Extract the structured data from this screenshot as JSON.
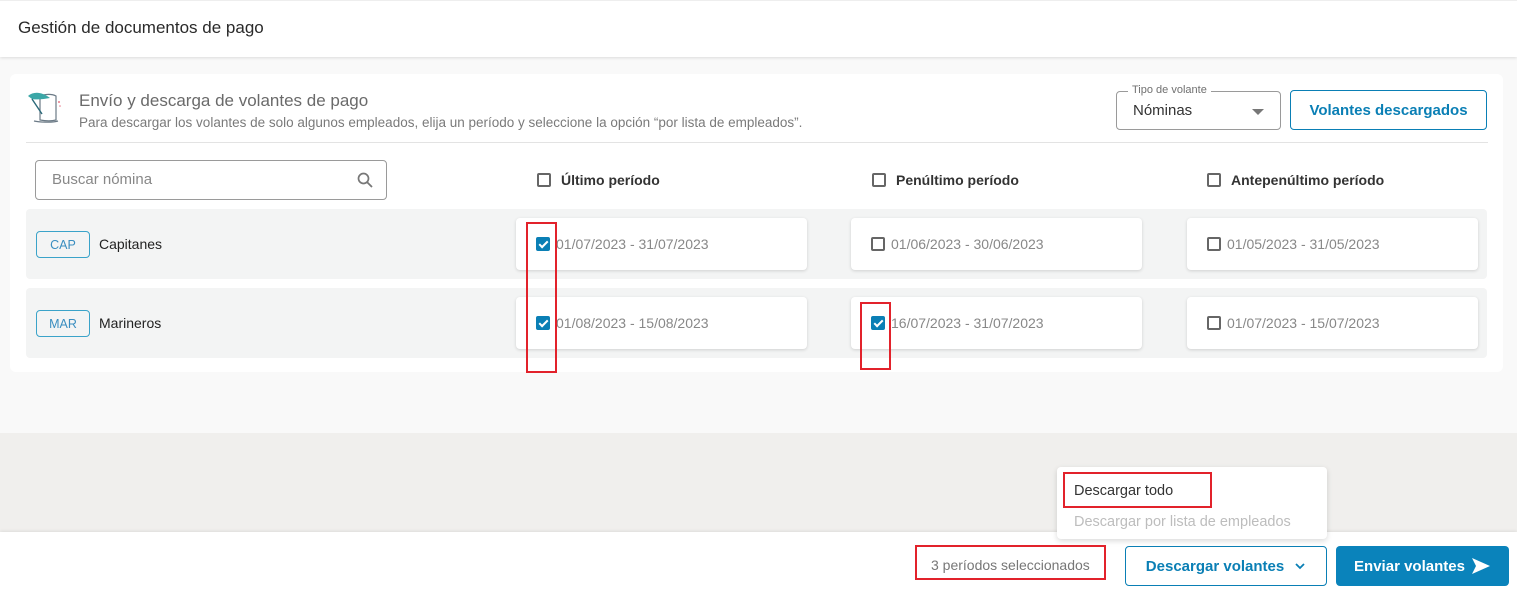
{
  "header": {
    "title": "Gestión de documentos de pago"
  },
  "card": {
    "icon": "scroll-quill-icon",
    "title": "Envío y descarga de volantes de pago",
    "subtitle": "Para descargar los volantes de solo algunos empleados, elija un período y seleccione la opción “por lista de empleados”.",
    "tipo_volante": {
      "label": "Tipo de volante",
      "value": "Nóminas"
    },
    "volantes_descargados_label": "Volantes descargados"
  },
  "search": {
    "placeholder": "Buscar nómina",
    "value": ""
  },
  "columns": [
    {
      "label": "Último período",
      "checked": false
    },
    {
      "label": "Penúltimo período",
      "checked": false
    },
    {
      "label": "Antepenúltimo período",
      "checked": false
    }
  ],
  "rows": [
    {
      "tag": "CAP",
      "name": "Capitanes",
      "periods": [
        {
          "range": "01/07/2023 - 31/07/2023",
          "checked": true
        },
        {
          "range": "01/06/2023 - 30/06/2023",
          "checked": false
        },
        {
          "range": "01/05/2023 - 31/05/2023",
          "checked": false
        }
      ]
    },
    {
      "tag": "MAR",
      "name": "Marineros",
      "periods": [
        {
          "range": "01/08/2023 - 15/08/2023",
          "checked": true
        },
        {
          "range": "16/07/2023 - 31/07/2023",
          "checked": true
        },
        {
          "range": "01/07/2023 - 15/07/2023",
          "checked": false
        }
      ]
    }
  ],
  "dropdown": {
    "items": [
      {
        "label": "Descargar todo",
        "enabled": true
      },
      {
        "label": "Descargar por lista de empleados",
        "enabled": false
      }
    ]
  },
  "footer": {
    "selected_count": "3 períodos seleccionados",
    "descargar_label": "Descargar volantes",
    "enviar_label": "Enviar volantes"
  },
  "colors": {
    "accent": "#0a7fb5",
    "primary_button": "#0a83bb",
    "highlight": "#e2222b"
  }
}
